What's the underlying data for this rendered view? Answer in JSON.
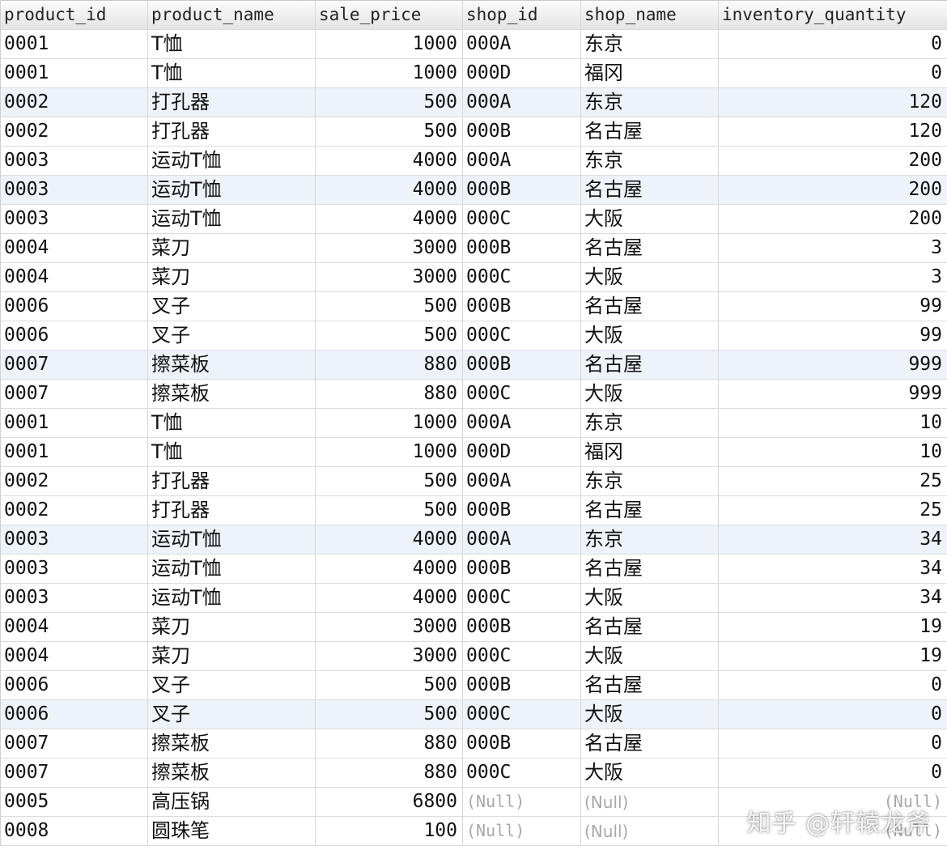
{
  "columns": [
    "product_id",
    "product_name",
    "sale_price",
    "shop_id",
    "shop_name",
    "inventory_quantity"
  ],
  "null_text": "(Null)",
  "rows": [
    [
      "0001",
      "T恤",
      "1000",
      "000A",
      "东京",
      "0"
    ],
    [
      "0001",
      "T恤",
      "1000",
      "000D",
      "福冈",
      "0"
    ],
    [
      "0002",
      "打孔器",
      "500",
      "000A",
      "东京",
      "120"
    ],
    [
      "0002",
      "打孔器",
      "500",
      "000B",
      "名古屋",
      "120"
    ],
    [
      "0003",
      "运动T恤",
      "4000",
      "000A",
      "东京",
      "200"
    ],
    [
      "0003",
      "运动T恤",
      "4000",
      "000B",
      "名古屋",
      "200"
    ],
    [
      "0003",
      "运动T恤",
      "4000",
      "000C",
      "大阪",
      "200"
    ],
    [
      "0004",
      "菜刀",
      "3000",
      "000B",
      "名古屋",
      "3"
    ],
    [
      "0004",
      "菜刀",
      "3000",
      "000C",
      "大阪",
      "3"
    ],
    [
      "0006",
      "叉子",
      "500",
      "000B",
      "名古屋",
      "99"
    ],
    [
      "0006",
      "叉子",
      "500",
      "000C",
      "大阪",
      "99"
    ],
    [
      "0007",
      "擦菜板",
      "880",
      "000B",
      "名古屋",
      "999"
    ],
    [
      "0007",
      "擦菜板",
      "880",
      "000C",
      "大阪",
      "999"
    ],
    [
      "0001",
      "T恤",
      "1000",
      "000A",
      "东京",
      "10"
    ],
    [
      "0001",
      "T恤",
      "1000",
      "000D",
      "福冈",
      "10"
    ],
    [
      "0002",
      "打孔器",
      "500",
      "000A",
      "东京",
      "25"
    ],
    [
      "0002",
      "打孔器",
      "500",
      "000B",
      "名古屋",
      "25"
    ],
    [
      "0003",
      "运动T恤",
      "4000",
      "000A",
      "东京",
      "34"
    ],
    [
      "0003",
      "运动T恤",
      "4000",
      "000B",
      "名古屋",
      "34"
    ],
    [
      "0003",
      "运动T恤",
      "4000",
      "000C",
      "大阪",
      "34"
    ],
    [
      "0004",
      "菜刀",
      "3000",
      "000B",
      "名古屋",
      "19"
    ],
    [
      "0004",
      "菜刀",
      "3000",
      "000C",
      "大阪",
      "19"
    ],
    [
      "0006",
      "叉子",
      "500",
      "000B",
      "名古屋",
      "0"
    ],
    [
      "0006",
      "叉子",
      "500",
      "000C",
      "大阪",
      "0"
    ],
    [
      "0007",
      "擦菜板",
      "880",
      "000B",
      "名古屋",
      "0"
    ],
    [
      "0007",
      "擦菜板",
      "880",
      "000C",
      "大阪",
      "0"
    ],
    [
      "0005",
      "高压锅",
      "6800",
      null,
      null,
      null
    ],
    [
      "0008",
      "圆珠笔",
      "100",
      null,
      null,
      null
    ]
  ],
  "alt_rows": [
    2,
    5,
    11,
    17,
    23
  ],
  "colors": {
    "row_highlight": "#eef3fa",
    "null_text": "#a8a8a8"
  },
  "watermark": "知乎 @轩辕龙斧"
}
